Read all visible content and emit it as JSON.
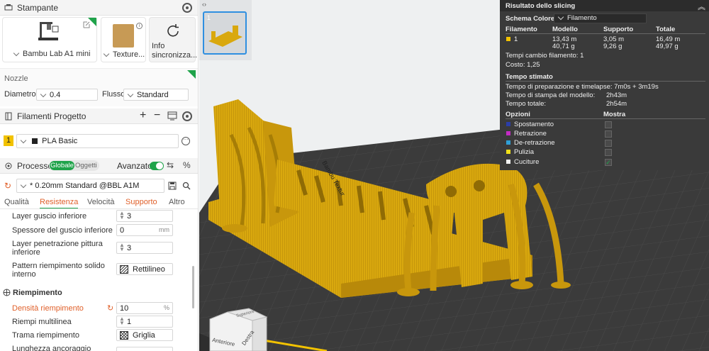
{
  "printer": {
    "title": "Stampante",
    "name": "Bambu Lab A1 mini",
    "plate": "Texture...",
    "sync": "Info sincronizza..."
  },
  "nozzle": {
    "title": "Nozzle",
    "diameter_label": "Diametro",
    "diameter_value": "0.4",
    "flow_label": "Flusso",
    "flow_value": "Standard"
  },
  "filament": {
    "title": "Filamenti Progetto",
    "index": "1",
    "name": "PLA Basic"
  },
  "process": {
    "title": "Processo",
    "toggle_global": "Globale",
    "toggle_objects": "Oggetti",
    "advanced_label": "Avanzato",
    "preset": "* 0.20mm Standard @BBL A1M",
    "tabs": [
      "Qualità",
      "Resistenza",
      "Velocità",
      "Supporto",
      "Altro"
    ]
  },
  "settings": {
    "bottom_layers_label": "Layer guscio inferiore",
    "bottom_layers_value": "3",
    "bottom_thickness_label": "Spessore del guscio inferiore",
    "bottom_thickness_value": "0",
    "bottom_thickness_unit": "mm",
    "paint_layers_label_1": "Layer penetrazione pittura",
    "paint_layers_label_2": "inferiore",
    "paint_layers_value": "3",
    "solid_pattern_label_1": "Pattern riempimento solido",
    "solid_pattern_label_2": "interno",
    "solid_pattern_value": "Rettilineo",
    "infill_section": "Riempimento",
    "density_label": "Densità riempimento",
    "density_value": "10",
    "density_unit": "%",
    "multiline_label": "Riempi multilinea",
    "multiline_value": "1",
    "pattern_label": "Trama riempimento",
    "pattern_value": "Griglia",
    "anchor_label": "Lunghezza ancoraggio"
  },
  "thumbnail": {
    "index": "1"
  },
  "bed_text": "Bambu Textur",
  "cube": {
    "front": "Anteriore",
    "right": "Destra",
    "top": "Superiore"
  },
  "slicing": {
    "title": "Risultato dello slicing",
    "color_scheme_label": "Schema Colore",
    "color_scheme_value": "Filamento",
    "columns": [
      "Filamento",
      "Modello",
      "Supporto",
      "Totale"
    ],
    "row_id": "1",
    "model": [
      "13,43 m",
      "40,71 g"
    ],
    "support": [
      "3,05 m",
      "9,26 g"
    ],
    "total": [
      "16,49 m",
      "49,97 g"
    ],
    "filament_changes": "Tempi cambio filamento:  1",
    "cost": "Costo:  1,25",
    "time_title": "Tempo stimato",
    "prep_time": "Tempo di preparazione e timelapse: 7m0s + 3m19s",
    "model_time_label": "Tempo di stampa del modello:",
    "model_time_value": "2h43m",
    "total_time_label": "Tempo totale:",
    "total_time_value": "2h54m",
    "options_label": "Opzioni",
    "show_label": "Mostra",
    "options": [
      {
        "label": "Spostamento",
        "color": "#2b3ea8"
      },
      {
        "label": "Retrazione",
        "color": "#c42bc4"
      },
      {
        "label": "De-retrazione",
        "color": "#2f9fd6"
      },
      {
        "label": "Pulizia",
        "color": "#f0e01a"
      },
      {
        "label": "Cuciture",
        "color": "#f2f2f2"
      }
    ]
  },
  "colors": {
    "accent_green": "#1fa34a",
    "accent_orange": "#e0602a",
    "model_yellow": "#d9a80e",
    "filament_yellow": "#f2c200"
  }
}
